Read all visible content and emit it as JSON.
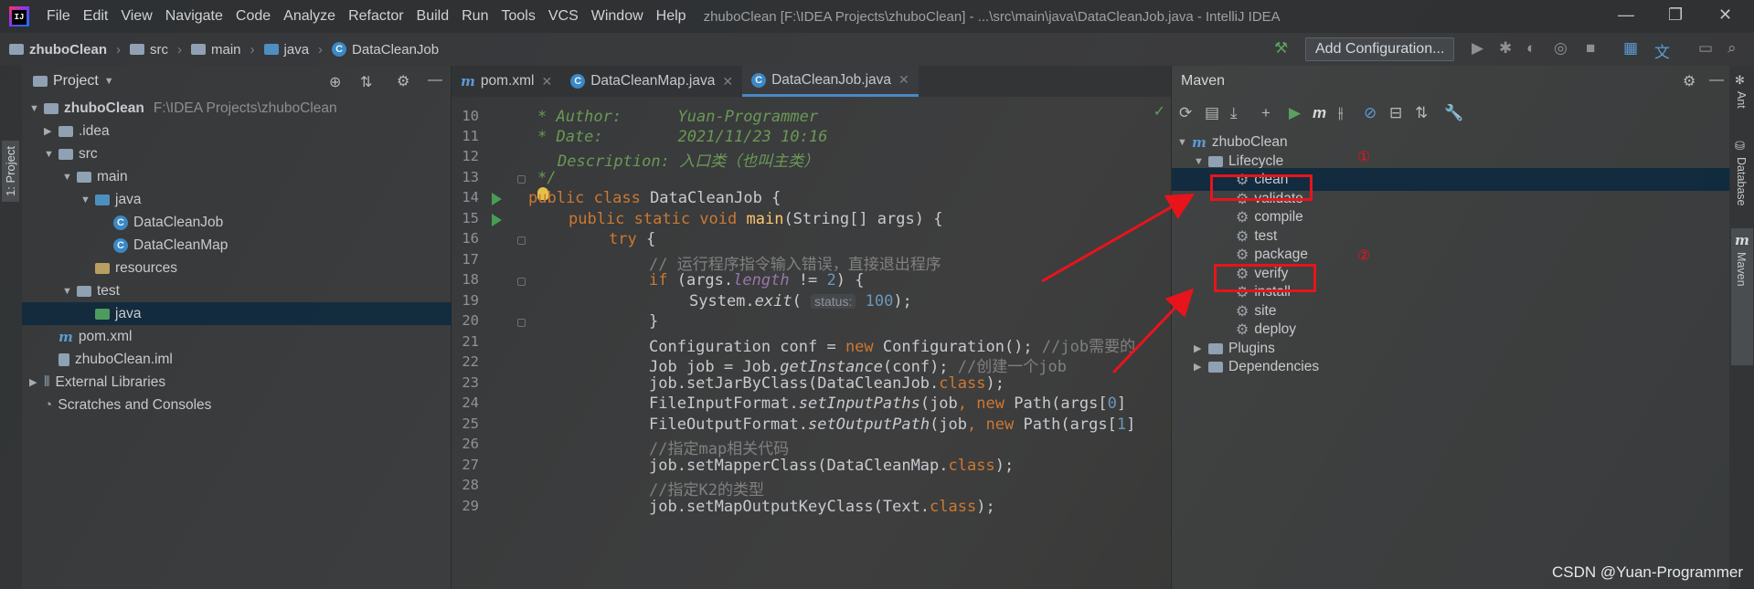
{
  "menu": {
    "items": [
      "File",
      "Edit",
      "View",
      "Navigate",
      "Code",
      "Analyze",
      "Refactor",
      "Build",
      "Run",
      "Tools",
      "VCS",
      "Window",
      "Help"
    ],
    "window_title": "zhuboClean [F:\\IDEA Projects\\zhuboClean] - ...\\src\\main\\java\\DataCleanJob.java - IntelliJ IDEA",
    "logo_text": "IJ"
  },
  "navbar": {
    "crumbs": [
      "zhuboClean",
      "src",
      "main",
      "java",
      "DataCleanJob"
    ],
    "add_configuration": "Add Configuration..."
  },
  "left_strip": {
    "project_tab": "1: Project"
  },
  "project": {
    "title": "Project",
    "tree": [
      {
        "label": "zhuboClean",
        "path": "F:\\IDEA Projects\\zhuboClean"
      },
      {
        "label": ".idea"
      },
      {
        "label": "src"
      },
      {
        "label": "main"
      },
      {
        "label": "java"
      },
      {
        "label": "DataCleanJob"
      },
      {
        "label": "DataCleanMap"
      },
      {
        "label": "resources"
      },
      {
        "label": "test"
      },
      {
        "label": "java"
      },
      {
        "label": "pom.xml"
      },
      {
        "label": "zhuboClean.iml"
      },
      {
        "label": "External Libraries"
      },
      {
        "label": "Scratches and Consoles"
      }
    ]
  },
  "editor": {
    "tabs": [
      "pom.xml",
      "DataCleanMap.java",
      "DataCleanJob.java"
    ],
    "line_numbers": [
      "10",
      "11",
      "12",
      "13",
      "14",
      "15",
      "16",
      "17",
      "18",
      "19",
      "20",
      "21",
      "22",
      "23",
      "24",
      "25",
      "26",
      "27",
      "28",
      "29"
    ],
    "code": {
      "l10_tag": "* Author:",
      "l10_val": "Yuan-Programmer",
      "l11_tag": "* Date:",
      "l11_val": "2021/11/23 10:16",
      "l12_tag": "Description:",
      "l12_val": "入口类（也叫主类）",
      "l13": "*/",
      "l14_kw": "public class",
      "l14_rest": " DataCleanJob {",
      "l15_kw": "public static void",
      "l15_fn": "main",
      "l15_rest": "(String[] args) {",
      "l16_kw": "try",
      "l16_rest": " {",
      "l17": "// 运行程序指令输入错误，直接退出程序",
      "l18_kw": "if",
      "l18_a": " (args.",
      "l18_field": "length",
      "l18_b": " != ",
      "l18_num": "2",
      "l18_c": ") {",
      "l19_a": "System.",
      "l19_fn": "exit",
      "l19_b": "( ",
      "l19_hint": "status:",
      "l19_num": "100",
      "l19_c": ");",
      "l20": "}",
      "l21_a": "Configuration conf = ",
      "l21_kw": "new",
      "l21_b": " Configuration(); ",
      "l21_cmt": "//job需要的",
      "l22_a": "Job job = Job.",
      "l22_fn": "getInstance",
      "l22_b": "(conf); ",
      "l22_cmt": "//创建一个job",
      "l23_a": "job.setJarByClass(DataCleanJob.",
      "l23_kw": "class",
      "l23_b": ");",
      "l24_a": "FileInputFormat.",
      "l24_fn": "setInputPaths",
      "l24_b": "(job",
      "l24_comma": ",",
      "l24_kw": " new",
      "l24_c": " Path(args[",
      "l24_num": "0",
      "l24_d": "]",
      "l25_a": "FileOutputFormat.",
      "l25_fn": "setOutputPath",
      "l25_b": "(job",
      "l25_comma": ",",
      "l25_kw": " new",
      "l25_c": " Path(args[",
      "l25_num": "1",
      "l25_d": "]",
      "l26": "//指定map相关代码",
      "l27_a": "job.setMapperClass(DataCleanMap.",
      "l27_kw": "class",
      "l27_b": ");",
      "l28": "//指定K2的类型",
      "l29_a": "job.setMapOutputKeyClass(Text.",
      "l29_kw": "class",
      "l29_b": ");"
    }
  },
  "maven": {
    "title": "Maven",
    "root": "zhuboClean",
    "lifecycle": "Lifecycle",
    "goals": [
      "clean",
      "validate",
      "compile",
      "test",
      "package",
      "verify",
      "install",
      "site",
      "deploy"
    ],
    "plugins": "Plugins",
    "dependencies": "Dependencies",
    "annotation_1": "①",
    "annotation_2": "②",
    "toolbar_m": "m"
  },
  "right_strip": {
    "ant": "Ant",
    "database": "Database",
    "maven": "Maven"
  },
  "watermark": "CSDN @Yuan-Programmer",
  "colors": {
    "accent": "#4a88c7",
    "annotation_red": "#e8141b",
    "run_green": "#499c54"
  }
}
